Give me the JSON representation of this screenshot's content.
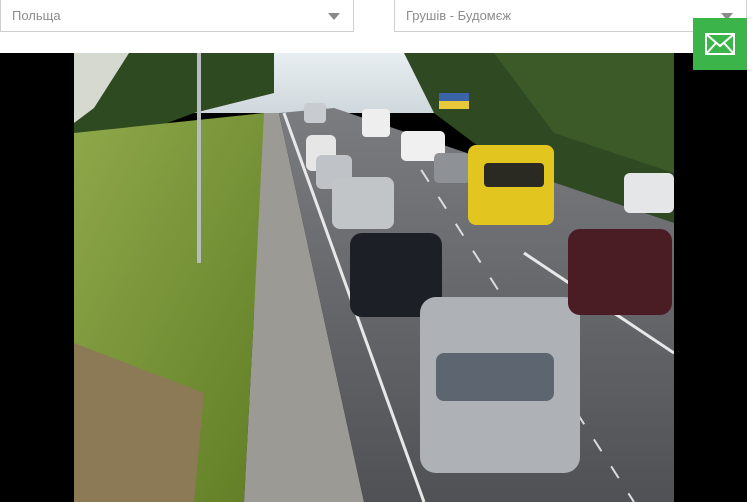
{
  "filters": {
    "country": {
      "value": "Польща"
    },
    "crossing": {
      "value": "Грушів - Будомєж"
    }
  },
  "camera": {
    "description_icon": "camera-feed",
    "colors": {
      "road": "#58595c",
      "grass": "#6b8a2a",
      "trees": "#2f4a22"
    }
  },
  "actions": {
    "mail_icon": "envelope-icon",
    "accent_color": "#3bb54a"
  }
}
